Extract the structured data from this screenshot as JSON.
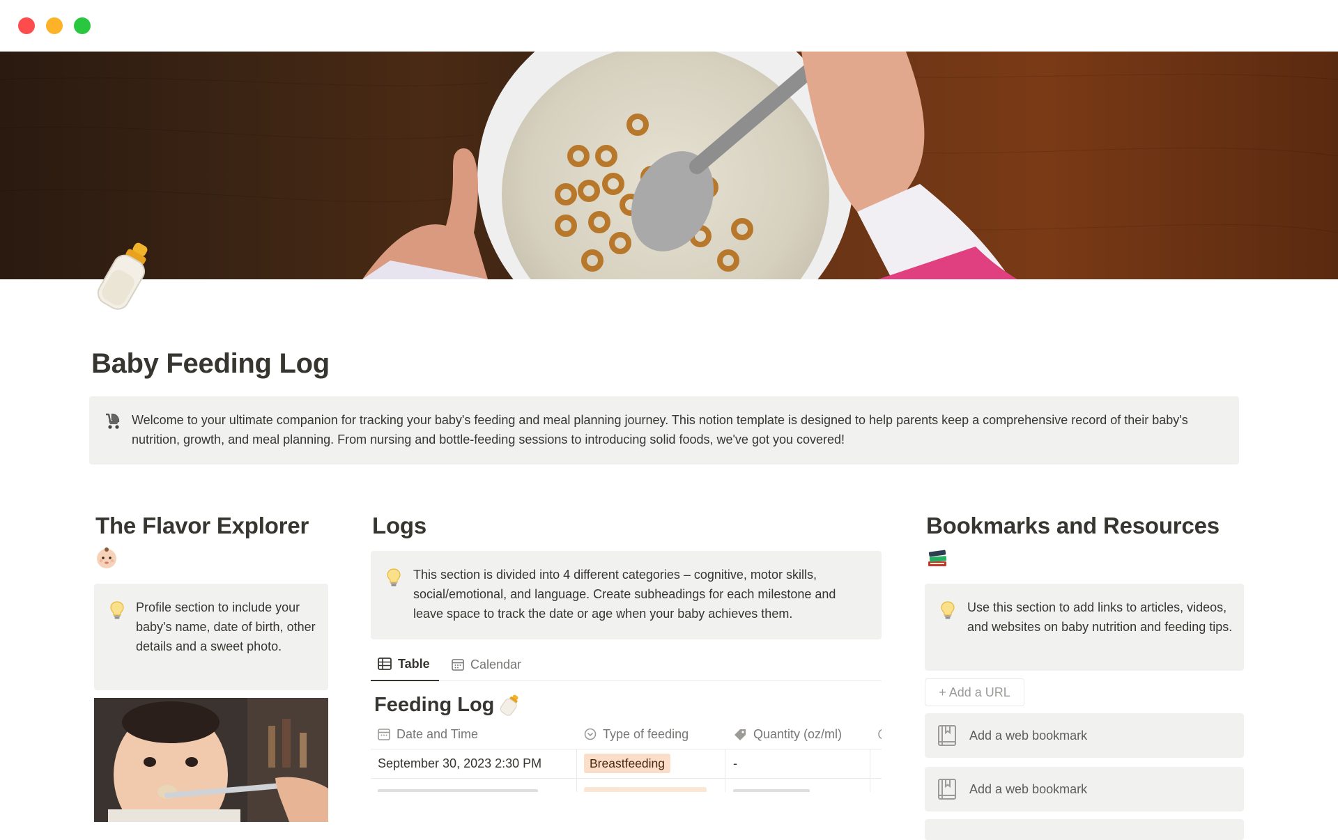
{
  "page": {
    "title": "Baby Feeding Log",
    "intro": "Welcome to your ultimate companion for tracking your baby's feeding and meal planning journey. This notion template is designed to help parents keep a comprehensive record of their baby's nutrition, growth, and meal planning. From nursing and bottle-feeding sessions to introducing solid foods, we've got you covered!",
    "intro_icon": "stroller-icon",
    "page_icon": "baby-bottle-icon"
  },
  "flavor": {
    "heading": "The Flavor Explorer",
    "emoji": "baby-face-icon",
    "callout": "Profile section to include your baby's name, date of birth, other details and a sweet photo."
  },
  "logs": {
    "heading": "Logs",
    "callout": "This section is divided into 4 different categories – cognitive, motor skills, social/emotional, and language. Create subheadings for each milestone and leave space to track the date or age when your baby achieves them.",
    "tabs": [
      {
        "label": "Table",
        "icon": "table-icon",
        "active": true
      },
      {
        "label": "Calendar",
        "icon": "calendar-icon",
        "active": false
      }
    ],
    "database": {
      "title": "Feeding Log",
      "columns": [
        {
          "label": "Date and Time",
          "icon": "calendar-icon"
        },
        {
          "label": "Type of feeding",
          "icon": "select-icon"
        },
        {
          "label": "Quantity (oz/ml)",
          "icon": "tag-icon"
        }
      ],
      "rows": [
        {
          "date": "September 30, 2023 2:30 PM",
          "type": "Breastfeeding",
          "quantity": "-"
        }
      ]
    }
  },
  "bookmarks": {
    "heading": "Bookmarks and Resources",
    "emoji": "books-icon",
    "callout": "Use this section to add links to articles, videos, and websites on baby nutrition and feeding tips.",
    "add_url": "+ Add a URL",
    "items": [
      {
        "label": "Add a web bookmark"
      },
      {
        "label": "Add a web bookmark"
      }
    ]
  },
  "colors": {
    "callout_bg": "#f1f1ef",
    "text": "#37352f",
    "muted": "#787774",
    "tag_bg": "#fadec9"
  }
}
